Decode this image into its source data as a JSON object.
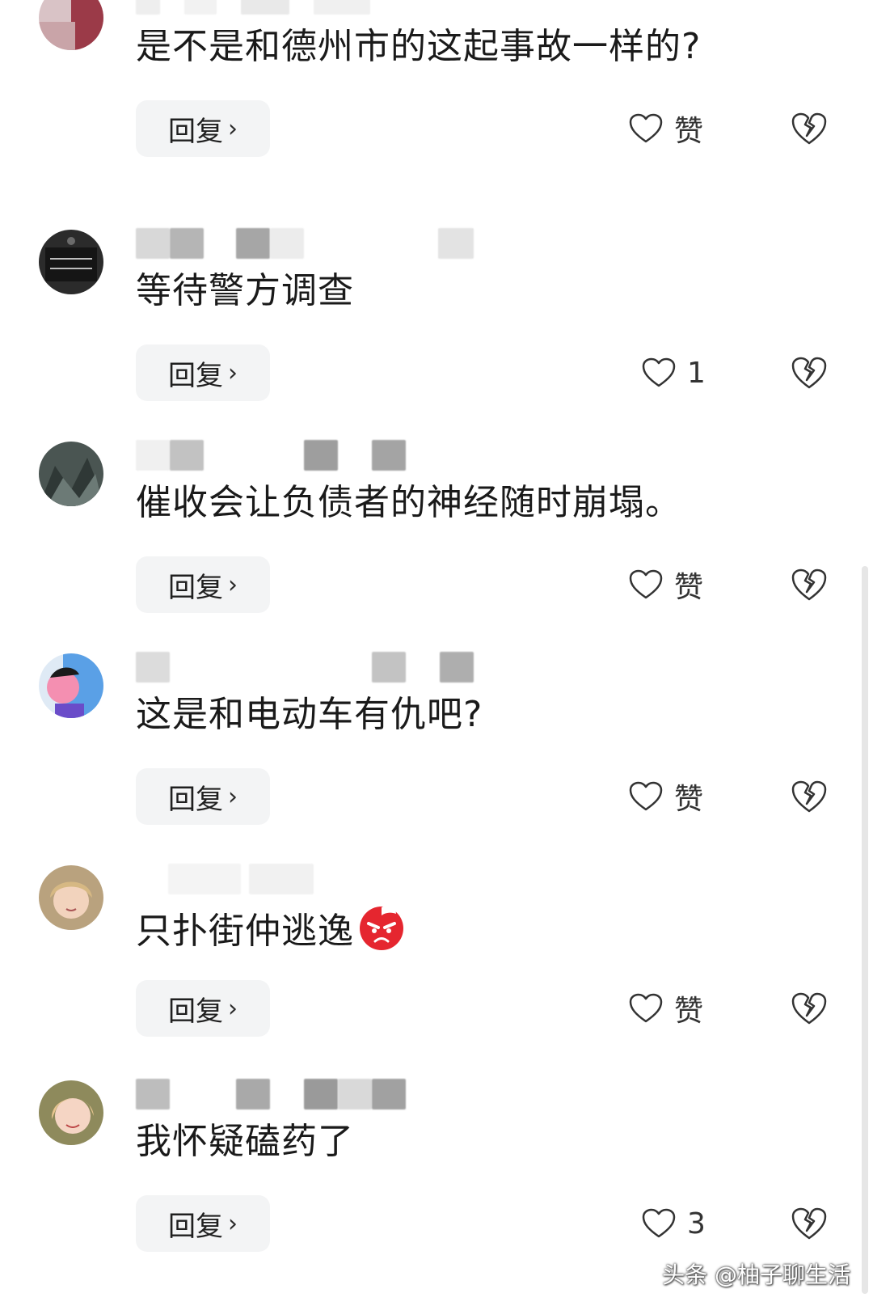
{
  "reply_label": "回复",
  "reply_chevron": "›",
  "icons": {
    "like": "heart-outline-icon",
    "dislike": "broken-heart-icon",
    "reply_chevron": "chevron-right-icon"
  },
  "colors": {
    "reply_bg": "#f3f4f5",
    "icon_stroke": "#333333",
    "text": "#1a1a1a"
  },
  "comments": [
    {
      "text": "是不是和德州市的这起事故一样的?",
      "likes": "赞"
    },
    {
      "text": "等待警方调查",
      "likes": "1"
    },
    {
      "text": "催收会让负债者的神经随时崩塌。",
      "likes": "赞"
    },
    {
      "text": "这是和电动车有仇吧?",
      "likes": "赞"
    },
    {
      "text": "只扑街仲逃逸",
      "emoji": "angry-face-icon",
      "likes": "赞"
    },
    {
      "text": "我怀疑磕药了",
      "likes": "3"
    }
  ],
  "watermark": "头条 @柚子聊生活"
}
